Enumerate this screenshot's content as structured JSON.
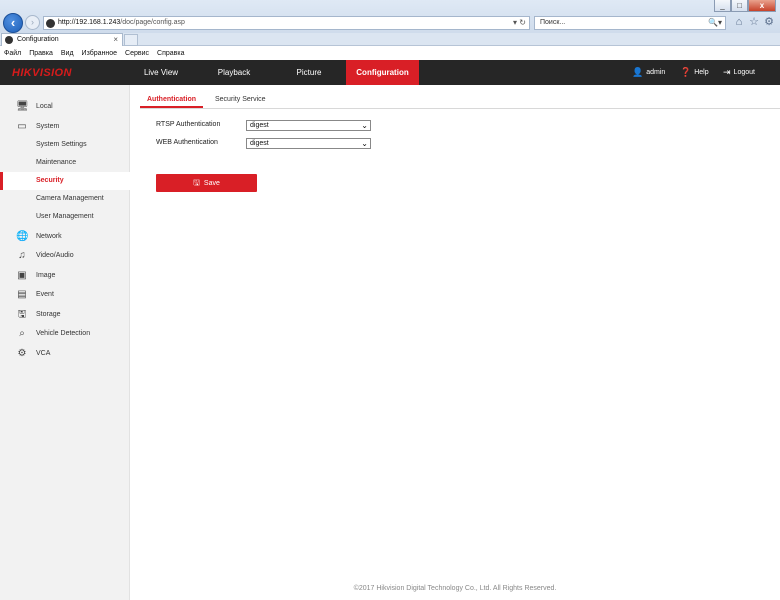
{
  "browser": {
    "window_controls": {
      "minimize": "_",
      "maximize": "□",
      "close": "x"
    },
    "address": {
      "host": "http://192.168.1.243",
      "path": "/doc/page/config.asp",
      "tools": "▾ ↻"
    },
    "search": {
      "placeholder": "Поиск...",
      "button": "🔍▾"
    },
    "tab": {
      "title": "Configuration",
      "close": "×"
    },
    "menu": [
      "Файл",
      "Правка",
      "Вид",
      "Избранное",
      "Сервис",
      "Справка"
    ]
  },
  "app": {
    "logo": "HIKVISION",
    "nav": {
      "live_view": "Live View",
      "playback": "Playback",
      "picture": "Picture",
      "configuration": "Configuration"
    },
    "user": "admin",
    "help": "Help",
    "logout": "Logout"
  },
  "sidebar": {
    "items": [
      {
        "label": "Local",
        "icon": "monitor-icon"
      },
      {
        "label": "System",
        "icon": "system-icon"
      },
      {
        "label": "System Settings",
        "sub": true
      },
      {
        "label": "Maintenance",
        "sub": true
      },
      {
        "label": "Security",
        "sub": true,
        "active": true
      },
      {
        "label": "Camera Management",
        "sub": true
      },
      {
        "label": "User Management",
        "sub": true
      },
      {
        "label": "Network",
        "icon": "globe-icon"
      },
      {
        "label": "Video/Audio",
        "icon": "video-audio-icon"
      },
      {
        "label": "Image",
        "icon": "image-icon"
      },
      {
        "label": "Event",
        "icon": "calendar-icon"
      },
      {
        "label": "Storage",
        "icon": "disk-icon"
      },
      {
        "label": "Vehicle Detection",
        "icon": "vehicle-search-icon"
      },
      {
        "label": "VCA",
        "icon": "vca-icon"
      }
    ]
  },
  "main": {
    "tabs": [
      {
        "label": "Authentication",
        "active": true
      },
      {
        "label": "Security Service",
        "active": false
      }
    ],
    "form": {
      "rtsp_label": "RTSP Authentication",
      "rtsp_value": "digest",
      "web_label": "WEB Authentication",
      "web_value": "digest"
    },
    "save_label": "Save"
  },
  "footer": "©2017 Hikvision Digital Technology Co., Ltd. All Rights Reserved.",
  "colors": {
    "accent": "#d91f26",
    "header_bg": "#262626",
    "sidebar_bg": "#f2f2f2"
  }
}
